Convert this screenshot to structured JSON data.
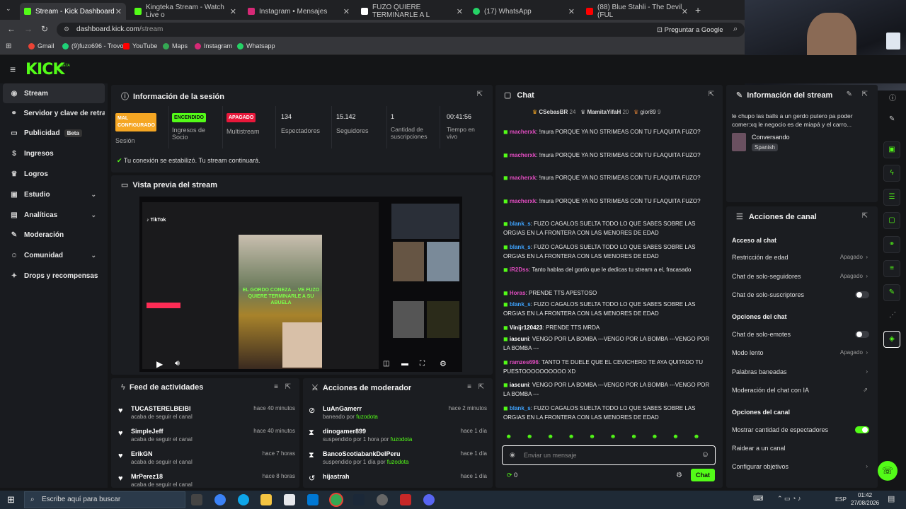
{
  "browser": {
    "tabs": [
      {
        "label": "Stream - Kick Dashboard",
        "color": "#53fc18"
      },
      {
        "label": "Kingteka Stream - Watch Live o",
        "color": "#53fc18"
      },
      {
        "label": "Instagram • Mensajes",
        "color": "#d62976"
      },
      {
        "label": "FUZO QUIERE TERMINARLE A L",
        "color": "#ffffff"
      },
      {
        "label": "(17) WhatsApp",
        "color": "#25d366"
      },
      {
        "label": "(88) Blue Stahli - The Devil (FUL",
        "color": "#ff0000"
      }
    ],
    "url_domain": "dashboard.kick.com",
    "url_path": "/stream",
    "ask_google": "Preguntar a Google",
    "bookmarks": [
      "Gmail",
      "(9)fuzo696 - Trovo",
      "YouTube",
      "Maps",
      "Instagram",
      "Whatsapp"
    ]
  },
  "brand": {
    "logo": "KICK",
    "beta": "BETA",
    "accent": "#53fc18"
  },
  "sidebar": {
    "items": [
      {
        "label": "Stream",
        "icon": "broadcast-icon"
      },
      {
        "label": "Servidor y clave de retransmisión",
        "icon": "link-icon"
      },
      {
        "label": "Publicidad",
        "icon": "ad-icon",
        "badge": "Beta"
      },
      {
        "label": "Ingresos",
        "icon": "money-icon"
      },
      {
        "label": "Logros",
        "icon": "trophy-icon"
      },
      {
        "label": "Estudio",
        "icon": "studio-icon"
      },
      {
        "label": "Analíticas",
        "icon": "chart-icon"
      },
      {
        "label": "Moderación",
        "icon": "wrench-icon"
      },
      {
        "label": "Comunidad",
        "icon": "community-icon"
      },
      {
        "label": "Drops y recompensas",
        "icon": "gift-icon"
      }
    ]
  },
  "session": {
    "title": "Información de la sesión",
    "stats": [
      {
        "badge": "MAL CONFIGURADO",
        "badge_color": "#f5a623",
        "label": "Sesión"
      },
      {
        "badge": "ENCENDIDO",
        "badge_color": "#53fc18",
        "label": "Ingresos de Socio"
      },
      {
        "badge": "APAGADO",
        "badge_color": "#e8173a",
        "label": "Multistream"
      },
      {
        "value": "134",
        "label": "Espectadores"
      },
      {
        "value": "15.142",
        "label": "Seguidores"
      },
      {
        "value": "1",
        "label": "Cantidad de suscripciones"
      },
      {
        "value": "00:41:56",
        "label": "Tiempo en vivo"
      }
    ],
    "status": "Tu conexión se estabilizó. Tu stream continuará."
  },
  "preview": {
    "title": "Vista previa del stream",
    "caption": "EL GORDO CONEZA ... VE FUZO QUIERE TERMINARLE A SU ABUELA"
  },
  "feed": {
    "title": "Feed de actividades",
    "items": [
      {
        "name": "TUCASTERELBEIBI",
        "desc": "acaba de seguir el canal",
        "time": "hace 40 minutos"
      },
      {
        "name": "SimpleJeff",
        "desc": "acaba de seguir el canal",
        "time": "hace 40 minutos"
      },
      {
        "name": "ErikGN",
        "desc": "acaba de seguir el canal",
        "time": "hace 7 horas"
      },
      {
        "name": "MrPerez18",
        "desc": "acaba de seguir el canal",
        "time": "hace 8 horas"
      }
    ]
  },
  "mod": {
    "title": "Acciones de moderador",
    "items": [
      {
        "name": "LuAnGamerr",
        "desc": "baneado por",
        "by": "fuzodota",
        "time": "hace 2 minutos",
        "icon": "ban-icon"
      },
      {
        "name": "dinogamer899",
        "desc": "suspendido por 1 hora por",
        "by": "fuzodota",
        "time": "hace 1 día",
        "icon": "hourglass-icon"
      },
      {
        "name": "BancoScotiabankDelPeru",
        "desc": "suspendido por 1 día por",
        "by": "fuzodota",
        "time": "hace 1 día",
        "icon": "hourglass-icon"
      },
      {
        "name": "hijastrah",
        "desc": "",
        "by": "",
        "time": "hace 1 día",
        "icon": "undo-icon"
      }
    ]
  },
  "chat": {
    "title": "Chat",
    "top": [
      {
        "name": "CSebasBR",
        "n": "24"
      },
      {
        "name": "MamitaYifaH",
        "n": "20"
      },
      {
        "name": "gior89",
        "n": "9"
      }
    ],
    "messages": [
      {
        "user": "macherxk",
        "color": "#e24dc1",
        "text": "!mura PORQUE YA NO STRIMEAS CON TU FLAQUITA FUZO?"
      },
      {
        "user": "macherxk",
        "color": "#e24dc1",
        "text": "!mura PORQUE YA NO STRIMEAS CON TU FLAQUITA FUZO?"
      },
      {
        "user": "macherxk",
        "color": "#e24dc1",
        "text": "!mura PORQUE YA NO STRIMEAS CON TU FLAQUITA FUZO?"
      },
      {
        "user": "macherxk",
        "color": "#e24dc1",
        "text": "!mura PORQUE YA NO STRIMEAS CON TU FLAQUITA FUZO?"
      },
      {
        "user": "blank_s",
        "color": "#3fa4ff",
        "text": "FUZO CAGALOS SUELTA TODO LO QUE SABES SOBRE LAS ORGIAS EN LA FRONTERA CON LAS MENORES DE EDAD"
      },
      {
        "user": "blank_s",
        "color": "#3fa4ff",
        "text": "FUZO CAGALOS SUELTA TODO LO QUE SABES SOBRE LAS ORGIAS EN LA FRONTERA CON LAS MENORES DE EDAD"
      },
      {
        "user": "iR2Dss",
        "color": "#e24dc1",
        "text": "Tanto hablas del gordo que le dedicas tu stream a el, fracasado"
      },
      {
        "user": "Horas",
        "color": "#e24dc1",
        "text": "PRENDE TTS APESTOSO"
      },
      {
        "user": "blank_s",
        "color": "#3fa4ff",
        "text": "FUZO CAGALOS SUELTA TODO LO QUE SABES SOBRE LAS ORGIAS EN LA FRONTERA CON LAS MENORES DE EDAD"
      },
      {
        "user": "Vinijr120423",
        "color": "#ffffff",
        "text": "PRENDE TTS MRDA"
      },
      {
        "user": "iascuni",
        "color": "#ffffff",
        "text": "VENGO POR LA BOMBA ---VENGO POR LA BOMBA ---VENGO POR LA BOMBA ---"
      },
      {
        "user": "ramzes696",
        "color": "#e24dc1",
        "text": "TANTO TE DUELE QUE EL CEVICHERO TE AYA QUITADO TU PUESTOOOOOOOOOO XD"
      },
      {
        "user": "iascuni",
        "color": "#ffffff",
        "text": "VENGO POR LA BOMBA ---VENGO POR LA BOMBA ---VENGO POR LA BOMBA ---"
      },
      {
        "user": "blank_s",
        "color": "#3fa4ff",
        "text": "FUZO CAGALOS SUELTA TODO LO QUE SABES SOBRE LAS ORGIAS EN LA FRONTERA CON LAS MENORES DE EDAD"
      }
    ],
    "input_placeholder": "Enviar un mensaje",
    "points": "0",
    "send": "Chat"
  },
  "streaminfo": {
    "title": "Información del stream",
    "desc": "le chupo las balls a un gerdo putero pa poder comer:xq le negocio es de miapá y el carro...",
    "category": "Conversando",
    "lang": "Spanish"
  },
  "channel": {
    "title": "Acciones de canal",
    "access_h": "Acceso al chat",
    "restriction": "Restricción de edad",
    "restriction_val": "Apagado",
    "followers": "Chat de solo-seguidores",
    "followers_val": "Apagado",
    "subs": "Chat de solo-suscriptores",
    "chat_h": "Opciones del chat",
    "emotes": "Chat de solo-emotes",
    "slow": "Modo lento",
    "slow_val": "Apagado",
    "banned": "Palabras baneadas",
    "ai": "Moderación del chat con IA",
    "canal_h": "Opciones del canal",
    "viewers": "Mostrar cantidad de espectadores",
    "raid": "Raidear a un canal",
    "goals": "Configurar objetivos"
  },
  "taskbar": {
    "search": "Escribe aquí para buscar",
    "time": "01:42",
    "date": "27/08/2026",
    "lang": "ESP"
  }
}
